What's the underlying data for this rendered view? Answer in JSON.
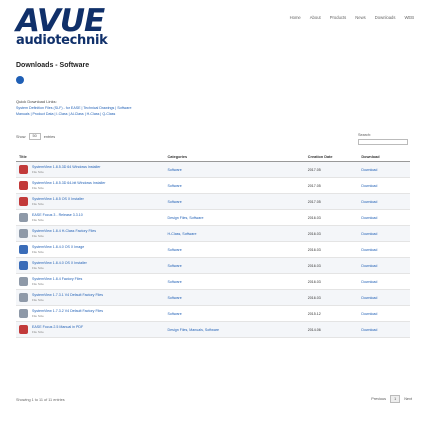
{
  "logo": {
    "main": "AVUE",
    "sub": "audiotechnik"
  },
  "nav": [
    "Home",
    "About",
    "Products",
    "News",
    "Downloads",
    "WEB"
  ],
  "page_title": "Downloads - Software",
  "quick_links": {
    "title": "Quick Download Links:",
    "line1": "System Definition Files (SLF) - for EASE | Technical Drawings | Software",
    "line2": "Manuals | Product Data | I-Class | Al-Class | H-Class | Q-Class"
  },
  "show": {
    "label_before": "Show",
    "value": "50",
    "label_after": "entries"
  },
  "search": {
    "label": "Search:"
  },
  "table": {
    "headers": [
      "Title",
      "Categories",
      "Creation Date",
      "Download"
    ],
    "rows": [
      {
        "title": "SystemView 1.8.5.3D 64 Windows Installer",
        "sub": "File Size",
        "category": "Software",
        "date": "2017.05",
        "download": "Download",
        "icon": "red"
      },
      {
        "title": "SystemView 1.8.5.3D 64-bit Windows Installer",
        "sub": "File Size",
        "category": "Software",
        "date": "2017.05",
        "download": "Download",
        "icon": "red"
      },
      {
        "title": "SystemView 1.8.5 OS X Installer",
        "sub": "File Size",
        "category": "Software",
        "date": "2017.05",
        "download": "Download",
        "icon": "red"
      },
      {
        "title": "EASE Focus 3 - Release 3.3.10",
        "sub": "File Size",
        "category": "Design Files, Software",
        "date": "2016.03",
        "download": "Download",
        "icon": "gray"
      },
      {
        "title": "SystemView 1.8.4 H-Class Factory Files",
        "sub": "File Size",
        "category": "H-Class, Software",
        "date": "2016.03",
        "download": "Download",
        "icon": "gray"
      },
      {
        "title": "SystemView 1.8.4.0 OS X Image",
        "sub": "File Size",
        "category": "Software",
        "date": "2016.03",
        "download": "Download",
        "icon": "blue"
      },
      {
        "title": "SystemView 1.8.4.0 OS X Installer",
        "sub": "File Size",
        "category": "Software",
        "date": "2016.03",
        "download": "Download",
        "icon": "blue"
      },
      {
        "title": "SystemView 1.8.4 Factory Files",
        "sub": "File Size",
        "category": "Software",
        "date": "2016.03",
        "download": "Download",
        "icon": "gray"
      },
      {
        "title": "SystemView 1.7.3.1 V4 Default Factory Files",
        "sub": "File Size",
        "category": "Software",
        "date": "2016.03",
        "download": "Download",
        "icon": "gray"
      },
      {
        "title": "SystemView 1.7.3.2 V4 Default Factory Files",
        "sub": "File Size",
        "category": "Software",
        "date": "2015.12",
        "download": "Download",
        "icon": "gray"
      },
      {
        "title": "EASE Focus 2.5 Manual in PDF",
        "sub": "File Size",
        "category": "Design Files, Manuals, Software",
        "date": "2014.06",
        "download": "Download",
        "icon": "red"
      }
    ]
  },
  "footer": {
    "info": "Showing 1 to 11 of 11 entries"
  },
  "pager": {
    "prev": "Previous",
    "page": "1",
    "next": "Next"
  }
}
